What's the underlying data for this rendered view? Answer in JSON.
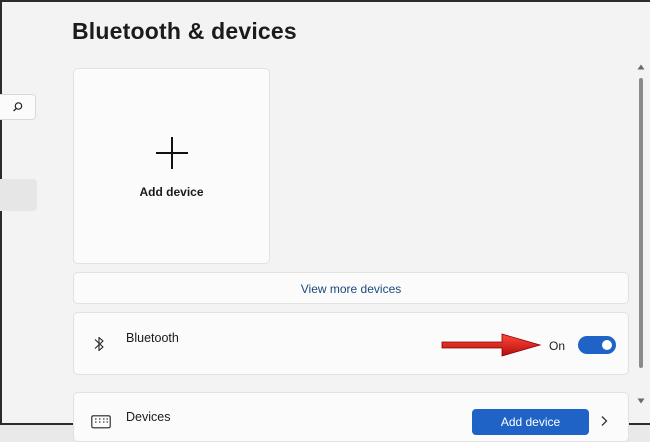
{
  "page": {
    "title": "Bluetooth & devices"
  },
  "sidebar": {
    "search_icon": "search-icon"
  },
  "add_device_card": {
    "label": "Add device",
    "icon": "plus-icon"
  },
  "view_more": {
    "label": "View more devices"
  },
  "bluetooth_row": {
    "icon": "bluetooth-icon",
    "title": "Bluetooth",
    "state_label": "On",
    "toggle_on": true
  },
  "devices_row": {
    "icon": "keyboard-icon",
    "title": "Devices",
    "button_label": "Add device"
  },
  "colors": {
    "accent": "#1f63c6",
    "annotation_arrow": "#d91a1a",
    "link": "#1a4a7e"
  }
}
